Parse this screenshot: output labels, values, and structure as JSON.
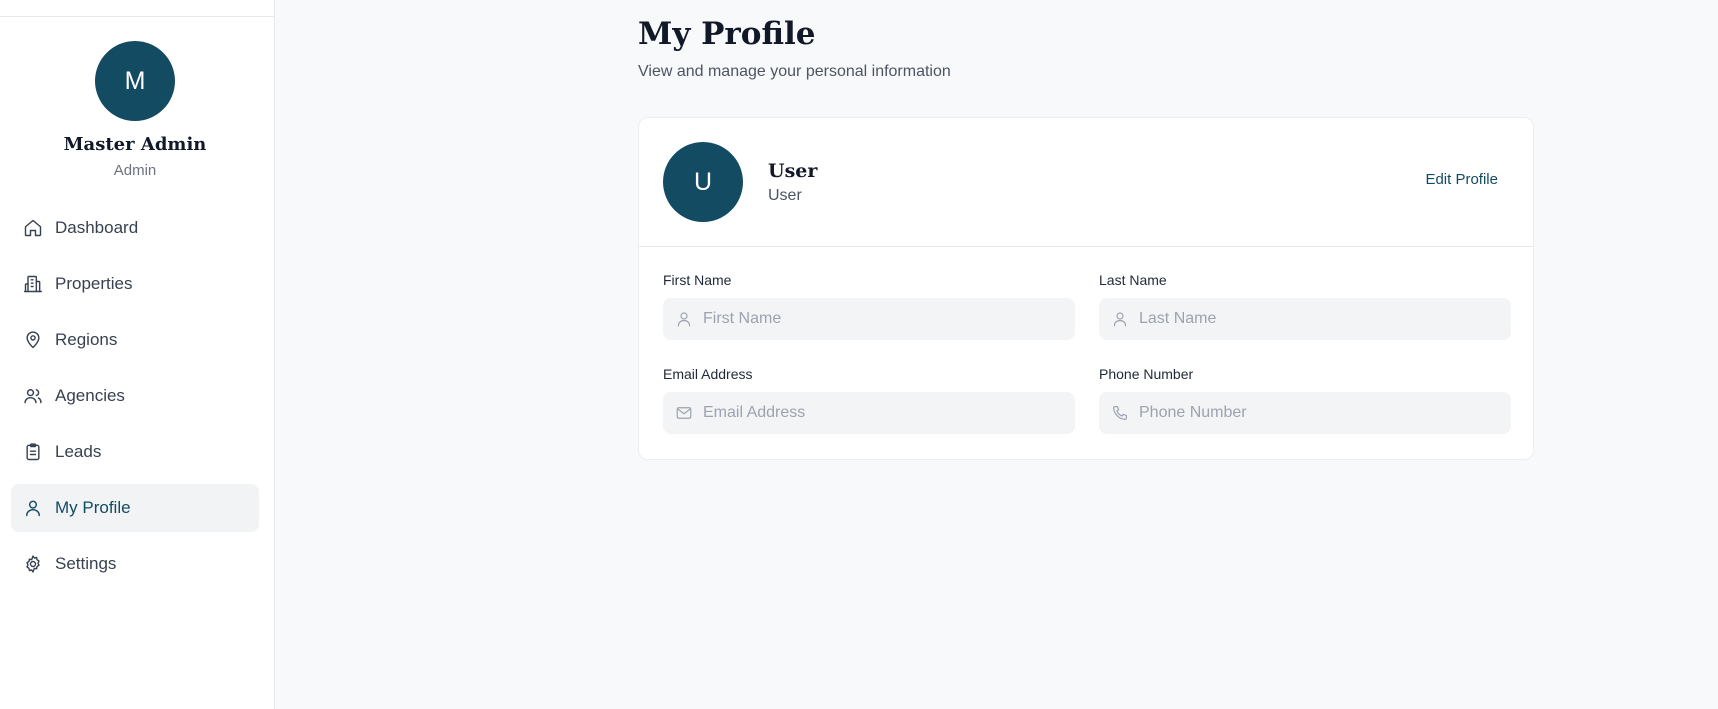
{
  "sidebar": {
    "avatar_initial": "M",
    "user_name": "Master Admin",
    "user_role": "Admin",
    "items": [
      {
        "label": "Dashboard",
        "icon": "home-icon"
      },
      {
        "label": "Properties",
        "icon": "building-icon"
      },
      {
        "label": "Regions",
        "icon": "map-pin-icon"
      },
      {
        "label": "Agencies",
        "icon": "users-icon"
      },
      {
        "label": "Leads",
        "icon": "clipboard-icon"
      },
      {
        "label": "My Profile",
        "icon": "user-icon",
        "active": true
      },
      {
        "label": "Settings",
        "icon": "gear-icon"
      }
    ]
  },
  "page": {
    "title": "My Profile",
    "subtitle": "View and manage your personal information"
  },
  "profile": {
    "avatar_initial": "U",
    "name": "User",
    "role": "User",
    "edit_label": "Edit Profile"
  },
  "form": {
    "first_name": {
      "label": "First Name",
      "placeholder": "First Name",
      "value": ""
    },
    "last_name": {
      "label": "Last Name",
      "placeholder": "Last Name",
      "value": ""
    },
    "email": {
      "label": "Email Address",
      "placeholder": "Email Address",
      "value": ""
    },
    "phone": {
      "label": "Phone Number",
      "placeholder": "Phone Number",
      "value": ""
    }
  },
  "colors": {
    "accent": "#134b63",
    "background": "#f8f9fb",
    "active_nav_bg": "#f1f3f5"
  }
}
